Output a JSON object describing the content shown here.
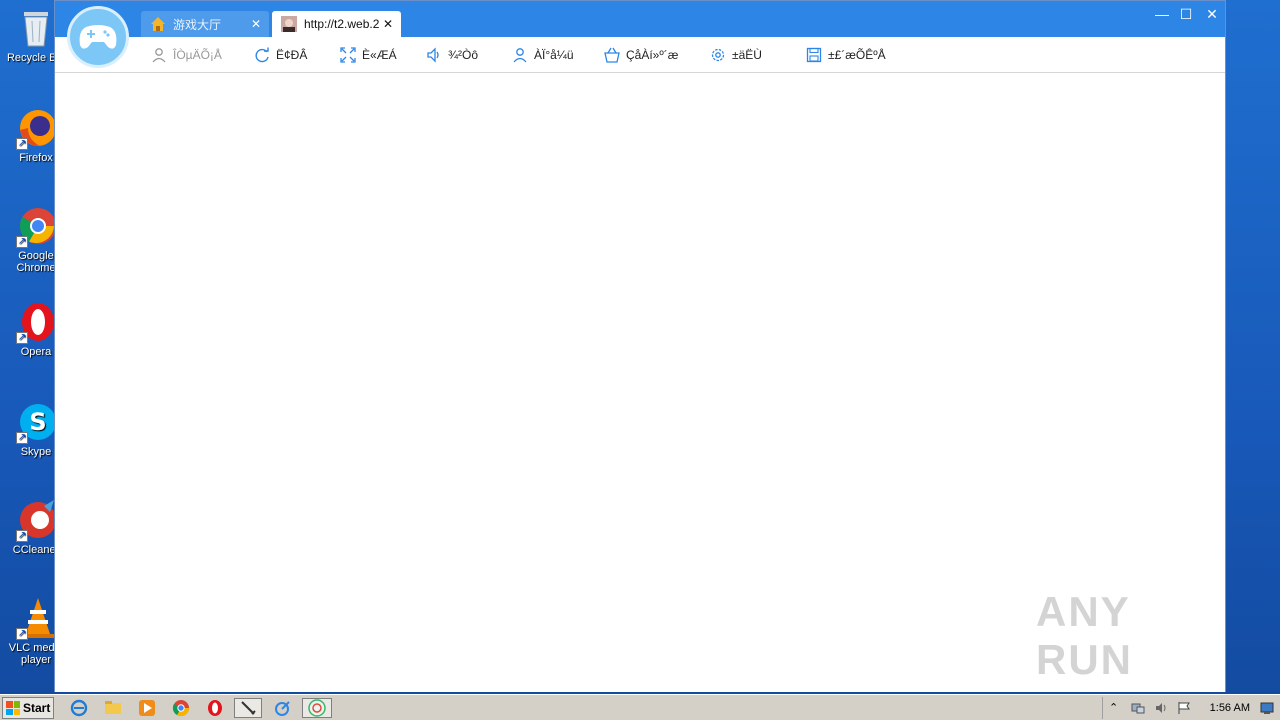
{
  "desktop": {
    "icons": [
      {
        "label": "Recycle Bin",
        "name": "recycle-bin"
      },
      {
        "label": "Firefox",
        "name": "firefox"
      },
      {
        "label": "Google Chrome",
        "name": "google-chrome"
      },
      {
        "label": "Opera",
        "name": "opera"
      },
      {
        "label": "Skype",
        "name": "skype"
      },
      {
        "label": "CCleaner",
        "name": "ccleaner"
      },
      {
        "label": "VLC media player",
        "name": "vlc"
      }
    ]
  },
  "window": {
    "tabs": [
      {
        "label": "游戏大厅",
        "close": "✕",
        "icon": "home-icon"
      },
      {
        "label": "http://t2.web.2",
        "close": "✕",
        "icon": "page-thumbnail-icon"
      }
    ],
    "controls": {
      "minimize": "—",
      "maximize": "☐",
      "close": "✕"
    },
    "toolbar": [
      {
        "label": "ÎÒµÄÕ¡Å",
        "icon": "user-icon",
        "disabled": true
      },
      {
        "label": "Ë¢ÐÂ",
        "icon": "refresh-icon",
        "disabled": false
      },
      {
        "label": "È«ÆÁ",
        "icon": "fullscreen-icon",
        "disabled": false
      },
      {
        "label": "¾²Òô",
        "icon": "speaker-icon",
        "disabled": false
      },
      {
        "label": "ÀÏ°å¼ü",
        "icon": "person-icon",
        "disabled": false
      },
      {
        "label": "ÇåÀí»º´æ",
        "icon": "basket-icon",
        "disabled": false
      },
      {
        "label": "±äËÙ",
        "icon": "gear-icon",
        "disabled": false
      },
      {
        "label": "±£´æÕÊºÅ",
        "icon": "save-icon",
        "disabled": false
      }
    ]
  },
  "watermark": "ANY RUN",
  "taskbar": {
    "start_label": "Start",
    "clock": "1:56 AM",
    "pinned": [
      "ie-icon",
      "explorer-icon",
      "media-player-icon",
      "chrome-icon",
      "opera-icon",
      "tool-icon",
      "speed-icon",
      "game-app-icon"
    ]
  },
  "colors": {
    "accent": "#2d86e6",
    "desktop": "#1858b8",
    "taskbar": "#d4d0c8"
  }
}
